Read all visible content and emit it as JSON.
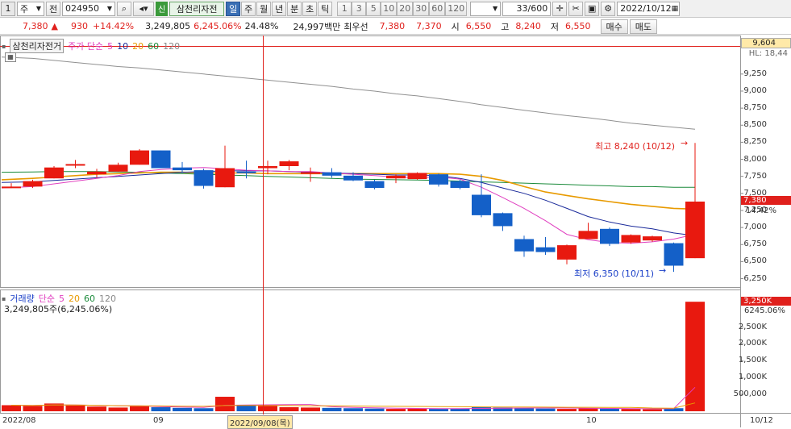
{
  "toolbar": {
    "window_number": "1",
    "market": "주",
    "market_type": "전",
    "stock_code": "024950",
    "credit_tag": "신",
    "stock_name": "삼천리자전",
    "periods": [
      "일",
      "주",
      "월",
      "년",
      "분",
      "초",
      "틱"
    ],
    "active_period": "일",
    "intervals": [
      "1",
      "3",
      "5",
      "10",
      "20",
      "30",
      "60",
      "120"
    ],
    "count": "33",
    "max_count": "/600",
    "date": "2022/10/12"
  },
  "quote": {
    "price": "7,380",
    "change_arrow": "▲",
    "change": "930",
    "change_pct": "+14.42%",
    "volume": "3,249,805",
    "volume_ratio": "6,245.06%",
    "turnover": "24.48%",
    "amount": "24,997백만",
    "best_label": "최우선",
    "ask": "7,380",
    "bid": "7,370",
    "open_label": "시",
    "open": "6,550",
    "high_label": "고",
    "high": "8,240",
    "low_label": "저",
    "low": "6,550",
    "buy_label": "매수",
    "sell_label": "매도"
  },
  "price_panel": {
    "stock_label": "삼천리자전거",
    "ma_label": "주가 단순",
    "ma_periods": [
      "5",
      "10",
      "20",
      "60",
      "120"
    ],
    "ma_colors": [
      "#e040c0",
      "#1a2a9a",
      "#e89a00",
      "#1a8a3a",
      "#888888"
    ],
    "price_axis_top_tag": "9,604",
    "price_axis_top_partial": "HL: 18,44",
    "price_ticks": [
      "9,250",
      "9,000",
      "8,750",
      "8,500",
      "8,250",
      "8,000",
      "7,750",
      "7,500",
      "7,250",
      "7,000",
      "6,750",
      "6,500",
      "6,250"
    ],
    "current_tag": "7,380",
    "current_pct": "14.42%",
    "high_annotation": "최고 8,240 (10/12)",
    "low_annotation": "최저 6,350 (10/11)"
  },
  "volume_panel": {
    "label": "거래량",
    "ma_label": "단순",
    "ma_periods": [
      "5",
      "20",
      "60",
      "120"
    ],
    "summary": "3,249,805주(6,245.06%)",
    "current_tag": "3,250K",
    "current_pct": "6245.06%",
    "volume_ticks": [
      "2,500K",
      "2,000K",
      "1,500K",
      "1,000K",
      "500,000"
    ]
  },
  "x_axis": {
    "labels": [
      "2022/08",
      "09",
      "2022/09/08(목)",
      "10",
      "10/12"
    ]
  },
  "chart_data": {
    "type": "candlestick",
    "candles": [
      {
        "o": 7600,
        "h": 7650,
        "l": 7580,
        "c": 7600
      },
      {
        "o": 7600,
        "h": 7700,
        "l": 7580,
        "c": 7680
      },
      {
        "o": 7720,
        "h": 7900,
        "l": 7720,
        "c": 7880
      },
      {
        "o": 7930,
        "h": 7990,
        "l": 7870,
        "c": 7930
      },
      {
        "o": 7780,
        "h": 7860,
        "l": 7730,
        "c": 7820
      },
      {
        "o": 7820,
        "h": 7950,
        "l": 7820,
        "c": 7920
      },
      {
        "o": 7920,
        "h": 8150,
        "l": 7920,
        "c": 8130
      },
      {
        "o": 8130,
        "h": 8130,
        "l": 7870,
        "c": 7870
      },
      {
        "o": 7880,
        "h": 7960,
        "l": 7800,
        "c": 7840
      },
      {
        "o": 7840,
        "h": 7860,
        "l": 7570,
        "c": 7610
      },
      {
        "o": 7590,
        "h": 8200,
        "l": 7590,
        "c": 7870
      },
      {
        "o": 7820,
        "h": 7980,
        "l": 7720,
        "c": 7800
      },
      {
        "o": 7870,
        "h": 7980,
        "l": 7780,
        "c": 7900
      },
      {
        "o": 7900,
        "h": 7990,
        "l": 7840,
        "c": 7970
      },
      {
        "o": 7790,
        "h": 7880,
        "l": 7670,
        "c": 7810
      },
      {
        "o": 7810,
        "h": 7870,
        "l": 7730,
        "c": 7760
      },
      {
        "o": 7760,
        "h": 7810,
        "l": 7680,
        "c": 7690
      },
      {
        "o": 7680,
        "h": 7700,
        "l": 7560,
        "c": 7580
      },
      {
        "o": 7720,
        "h": 7780,
        "l": 7650,
        "c": 7760
      },
      {
        "o": 7710,
        "h": 7810,
        "l": 7700,
        "c": 7800
      },
      {
        "o": 7780,
        "h": 7790,
        "l": 7600,
        "c": 7630
      },
      {
        "o": 7680,
        "h": 7700,
        "l": 7560,
        "c": 7580
      },
      {
        "o": 7480,
        "h": 7780,
        "l": 7150,
        "c": 7180
      },
      {
        "o": 7210,
        "h": 7220,
        "l": 6950,
        "c": 7020
      },
      {
        "o": 6830,
        "h": 6880,
        "l": 6570,
        "c": 6650
      },
      {
        "o": 6710,
        "h": 6860,
        "l": 6600,
        "c": 6640
      },
      {
        "o": 6530,
        "h": 6750,
        "l": 6460,
        "c": 6740
      },
      {
        "o": 6830,
        "h": 7070,
        "l": 6830,
        "c": 6950
      },
      {
        "o": 6980,
        "h": 7000,
        "l": 6730,
        "c": 6760
      },
      {
        "o": 6780,
        "h": 6900,
        "l": 6760,
        "c": 6890
      },
      {
        "o": 6810,
        "h": 6880,
        "l": 6790,
        "c": 6870
      },
      {
        "o": 6770,
        "h": 6780,
        "l": 6350,
        "c": 6440
      },
      {
        "o": 6550,
        "h": 8240,
        "l": 6550,
        "c": 7380
      }
    ],
    "volumes": [
      180000,
      160000,
      230000,
      170000,
      140000,
      110000,
      150000,
      120000,
      100000,
      90000,
      430000,
      180000,
      160000,
      120000,
      110000,
      100000,
      90000,
      80000,
      70000,
      80000,
      70000,
      80000,
      120000,
      110000,
      100000,
      80000,
      70000,
      90000,
      80000,
      70000,
      60000,
      90000,
      3249805
    ],
    "ma5": [
      7580,
      7600,
      7640,
      7680,
      7720,
      7760,
      7820,
      7850,
      7870,
      7880,
      7860,
      7840,
      7830,
      7820,
      7820,
      7800,
      7780,
      7760,
      7740,
      7730,
      7740,
      7710,
      7590,
      7440,
      7280,
      7100,
      6900,
      6820,
      6780,
      6770,
      6790,
      6830,
      6900
    ],
    "ma10": [
      7660,
      7670,
      7690,
      7710,
      7730,
      7750,
      7770,
      7790,
      7810,
      7820,
      7830,
      7830,
      7830,
      7820,
      7810,
      7800,
      7790,
      7780,
      7770,
      7770,
      7760,
      7720,
      7660,
      7580,
      7500,
      7400,
      7280,
      7160,
      7080,
      7020,
      6980,
      6920,
      6880
    ],
    "ma20": [
      7700,
      7720,
      7740,
      7760,
      7780,
      7790,
      7800,
      7810,
      7810,
      7800,
      7800,
      7800,
      7790,
      7790,
      7790,
      7790,
      7790,
      7790,
      7790,
      7790,
      7790,
      7780,
      7750,
      7690,
      7600,
      7520,
      7470,
      7420,
      7380,
      7340,
      7310,
      7280,
      7270
    ],
    "ma60": [
      7810,
      7815,
      7820,
      7820,
      7820,
      7815,
      7810,
      7800,
      7790,
      7780,
      7770,
      7760,
      7750,
      7740,
      7730,
      7720,
      7710,
      7705,
      7700,
      7695,
      7690,
      7680,
      7670,
      7660,
      7650,
      7640,
      7630,
      7620,
      7610,
      7600,
      7600,
      7590,
      7590
    ],
    "ma120": [
      9500,
      9480,
      9450,
      9420,
      9390,
      9360,
      9340,
      9310,
      9280,
      9250,
      9220,
      9190,
      9160,
      9130,
      9100,
      9070,
      9030,
      9000,
      8960,
      8930,
      8890,
      8850,
      8800,
      8760,
      8720,
      8680,
      8640,
      8610,
      8570,
      8530,
      8500,
      8470,
      8440
    ],
    "ylim": [
      6150,
      9650
    ],
    "volume_ylim": [
      0,
      3350000
    ]
  }
}
